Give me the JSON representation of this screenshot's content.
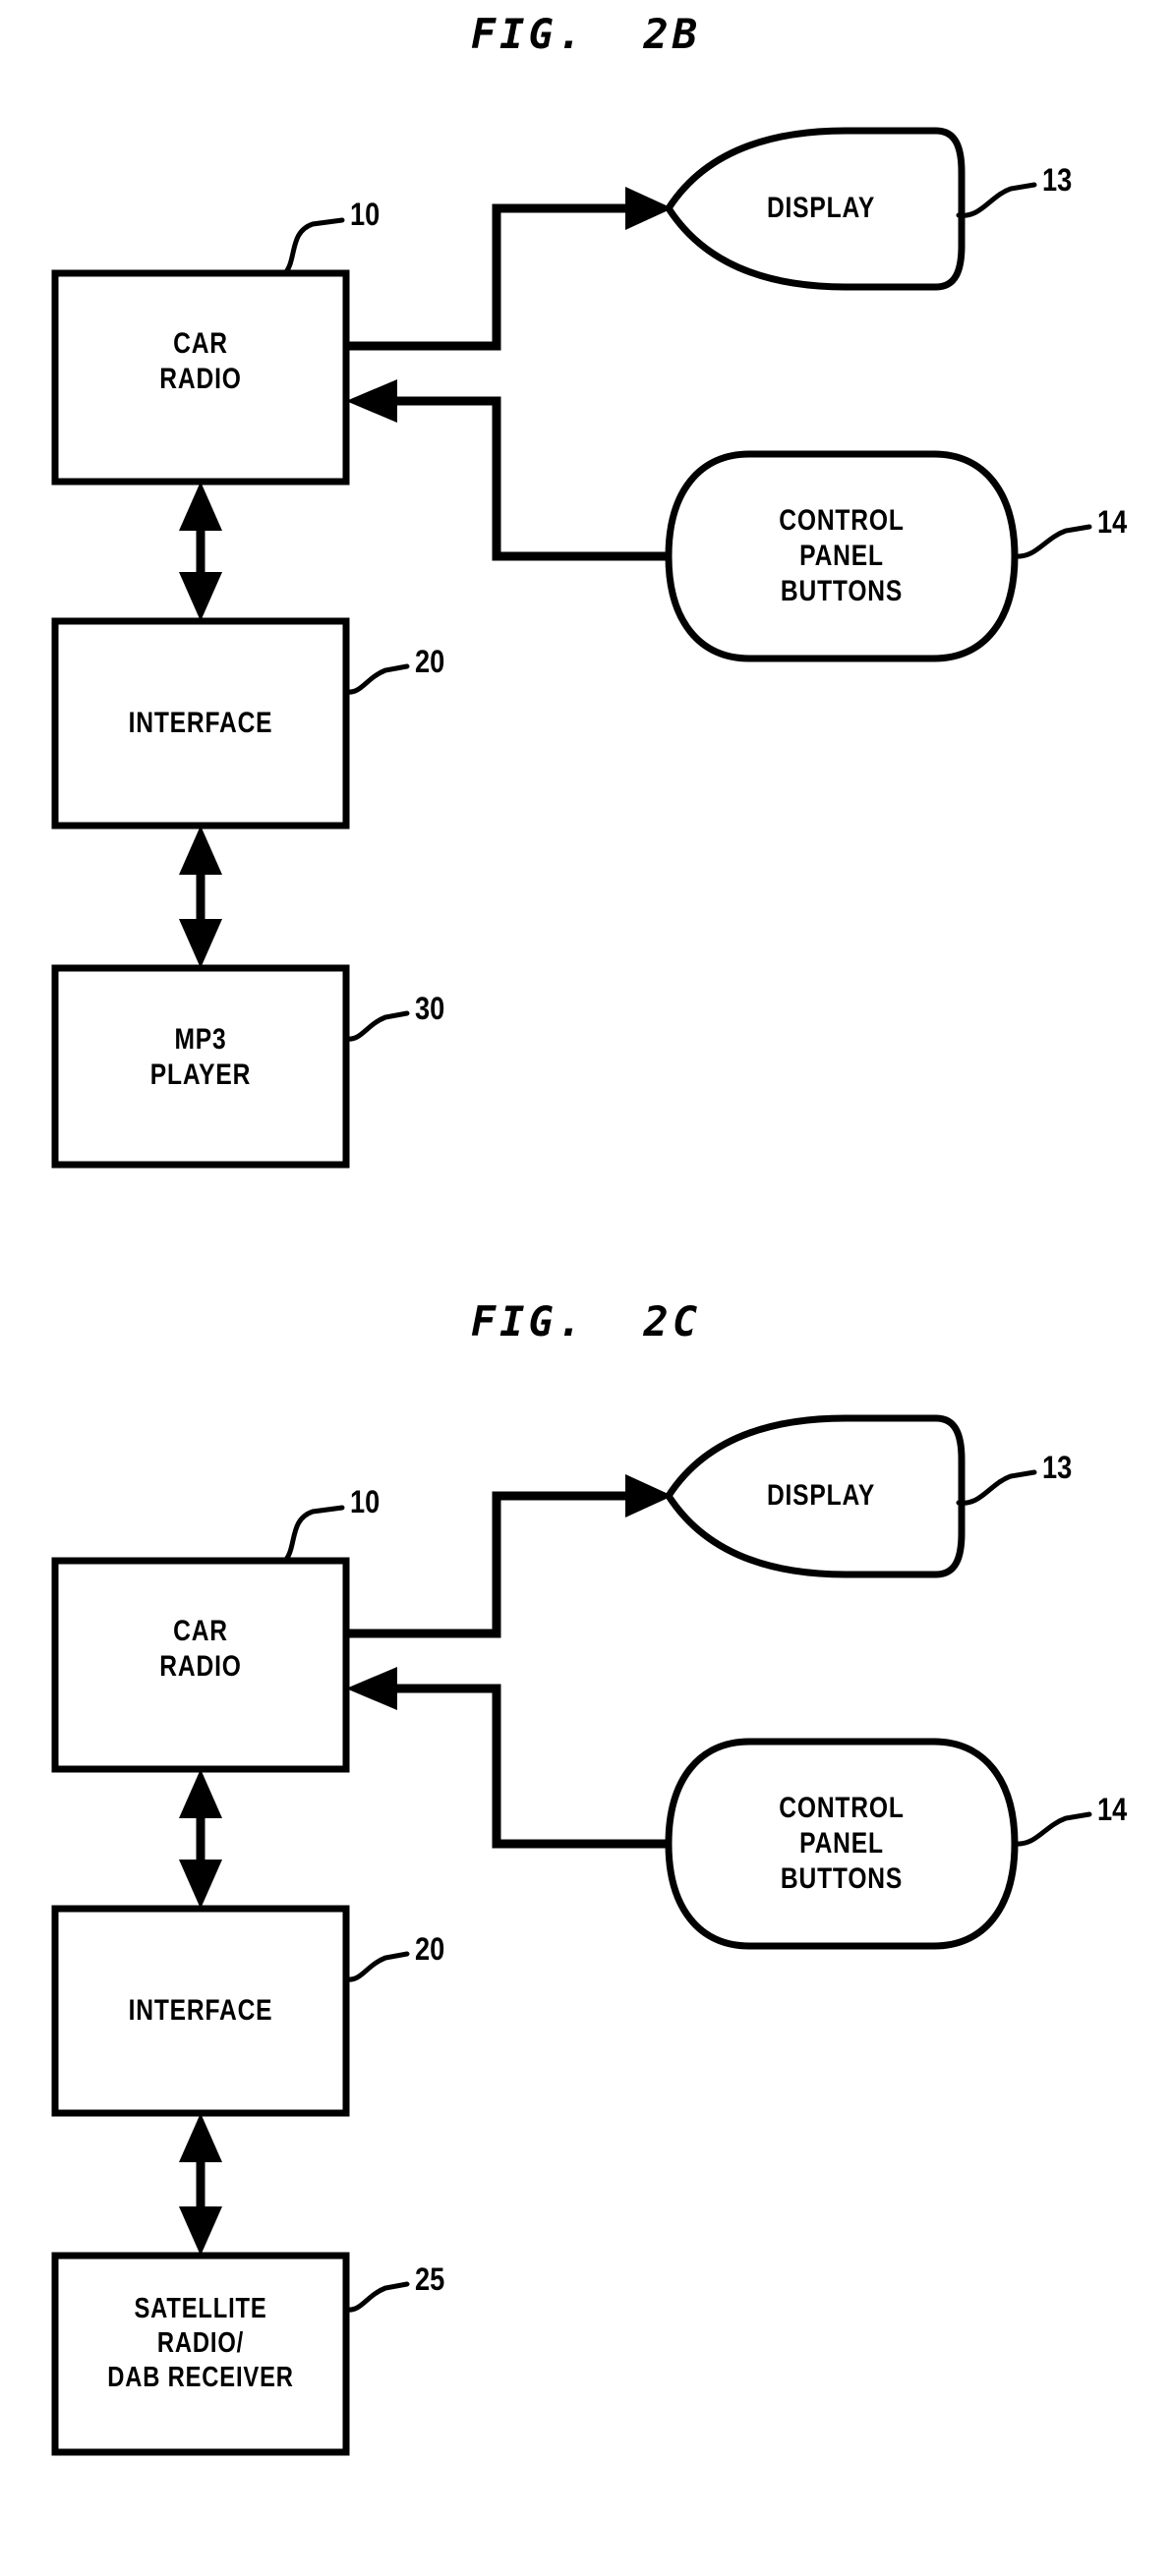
{
  "figures": [
    {
      "title": "FIG.  2B",
      "blocks": {
        "car_radio": "CAR\nRADIO",
        "interface": "INTERFACE",
        "bottom": "MP3\nPLAYER",
        "display": "DISPLAY",
        "control_panel": "CONTROL\nPANEL\nBUTTONS"
      },
      "refs": {
        "car_radio": "10",
        "interface": "20",
        "bottom": "30",
        "display": "13",
        "control_panel": "14"
      }
    },
    {
      "title": "FIG.  2C",
      "blocks": {
        "car_radio": "CAR\nRADIO",
        "interface": "INTERFACE",
        "bottom": "SATELLITE\nRADIO/\nDAB RECEIVER",
        "display": "DISPLAY",
        "control_panel": "CONTROL\nPANEL\nBUTTONS"
      },
      "refs": {
        "car_radio": "10",
        "interface": "20",
        "bottom": "25",
        "display": "13",
        "control_panel": "14"
      }
    }
  ],
  "style": {
    "ink": "#000000",
    "paper": "#ffffff"
  }
}
